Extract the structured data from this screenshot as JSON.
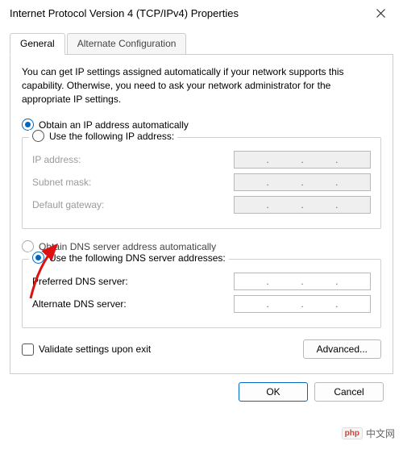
{
  "window": {
    "title": "Internet Protocol Version 4 (TCP/IPv4) Properties"
  },
  "tabs": {
    "general": "General",
    "alternate": "Alternate Configuration"
  },
  "description": "You can get IP settings assigned automatically if your network supports this capability. Otherwise, you need to ask your network administrator for the appropriate IP settings.",
  "ip": {
    "auto_label": "Obtain an IP address automatically",
    "manual_label": "Use the following IP address:",
    "address_label": "IP address:",
    "subnet_label": "Subnet mask:",
    "gateway_label": "Default gateway:"
  },
  "dns": {
    "auto_label": "Obtain DNS server address automatically",
    "manual_label": "Use the following DNS server addresses:",
    "preferred_label": "Preferred DNS server:",
    "alternate_label": "Alternate DNS server:"
  },
  "validate_label": "Validate settings upon exit",
  "buttons": {
    "advanced": "Advanced...",
    "ok": "OK",
    "cancel": "Cancel"
  },
  "watermark": "中文网"
}
